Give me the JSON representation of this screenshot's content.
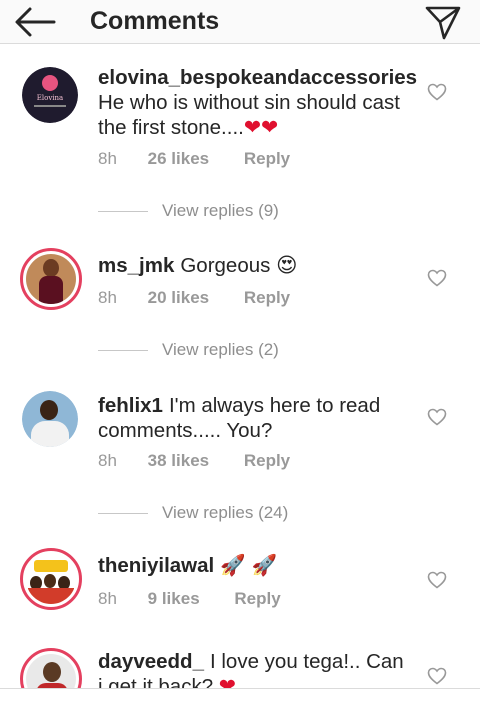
{
  "header": {
    "title": "Comments"
  },
  "comments": [
    {
      "username": "elovina_bespokeandaccessories",
      "text": "He who is without sin should cast the first stone....",
      "emoji": "❤❤",
      "time": "8h",
      "likes": "26 likes",
      "reply": "Reply",
      "view_replies": "View replies (9)",
      "avatar_text": "Elovina"
    },
    {
      "username": "ms_jmk",
      "text": "Gorgeous",
      "emoji": "😍",
      "time": "8h",
      "likes": "20 likes",
      "reply": "Reply",
      "view_replies": "View replies (2)"
    },
    {
      "username": "fehlix1",
      "text": "I'm always here to read comments..... You?",
      "emoji": "",
      "time": "8h",
      "likes": "38 likes",
      "reply": "Reply",
      "view_replies": "View replies (24)"
    },
    {
      "username": "theniyilawal",
      "text": "",
      "emoji": "🚀 🚀",
      "time": "8h",
      "likes": "9 likes",
      "reply": "Reply"
    },
    {
      "username": "dayveedd_",
      "text": "I love you tega!.. Can i get it back?",
      "emoji": "❤"
    }
  ],
  "colors": {
    "ring": "#e4405f",
    "meta_gray": "#999999",
    "heart_red": "#e0102f"
  }
}
